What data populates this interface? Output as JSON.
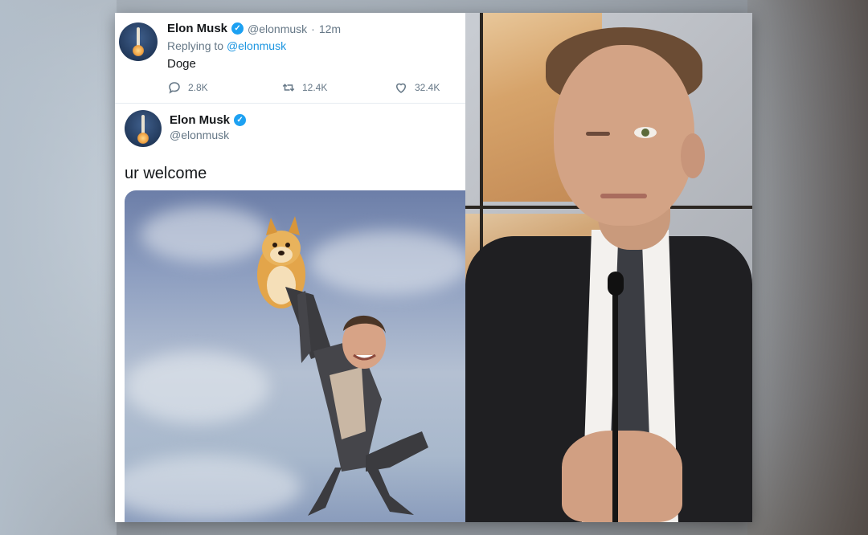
{
  "tweet1": {
    "name": "Elon Musk",
    "handle": "@elonmusk",
    "separator": "·",
    "time": "12m",
    "replying_prefix": "Replying to",
    "replying_to": "@elonmusk",
    "text": "Doge",
    "actions": {
      "replies": "2.8K",
      "retweets": "12.4K",
      "likes": "32.4K"
    }
  },
  "tweet2": {
    "name": "Elon Musk",
    "handle": "@elonmusk",
    "text": "ur welcome"
  },
  "icons": {
    "verified": "verified-badge-icon",
    "reply": "reply-icon",
    "retweet": "retweet-icon",
    "like": "heart-icon"
  },
  "colors": {
    "twitter_blue": "#1da1f2",
    "link_blue": "#1b95e0",
    "text_primary": "#14171a",
    "text_secondary": "#657786"
  }
}
